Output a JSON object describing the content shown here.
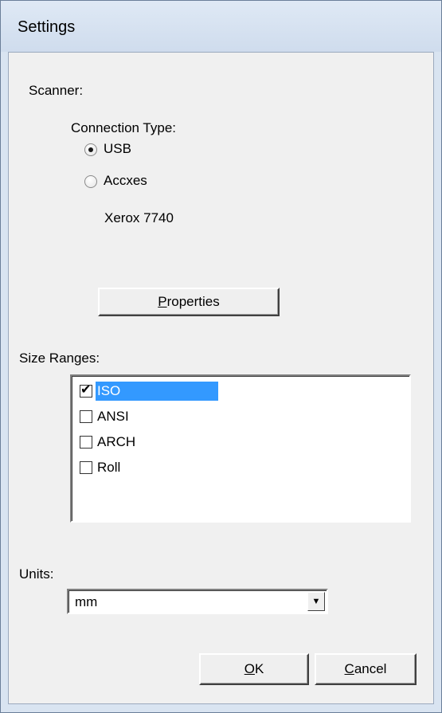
{
  "window": {
    "title": "Settings"
  },
  "scanner": {
    "label": "Scanner:",
    "connection_type_label": "Connection Type:",
    "options": [
      {
        "label": "USB",
        "selected": true
      },
      {
        "label": "Accxes",
        "selected": false
      }
    ],
    "device_name": "Xerox 7740",
    "properties_button": "Properties"
  },
  "size_ranges": {
    "label": "Size Ranges:",
    "items": [
      {
        "label": "ISO",
        "checked": true,
        "selected": true
      },
      {
        "label": "ANSI",
        "checked": false,
        "selected": false
      },
      {
        "label": "ARCH",
        "checked": false,
        "selected": false
      },
      {
        "label": "Roll",
        "checked": false,
        "selected": false
      }
    ]
  },
  "units": {
    "label": "Units:",
    "value": "mm"
  },
  "buttons": {
    "ok": "OK",
    "cancel": "Cancel"
  }
}
